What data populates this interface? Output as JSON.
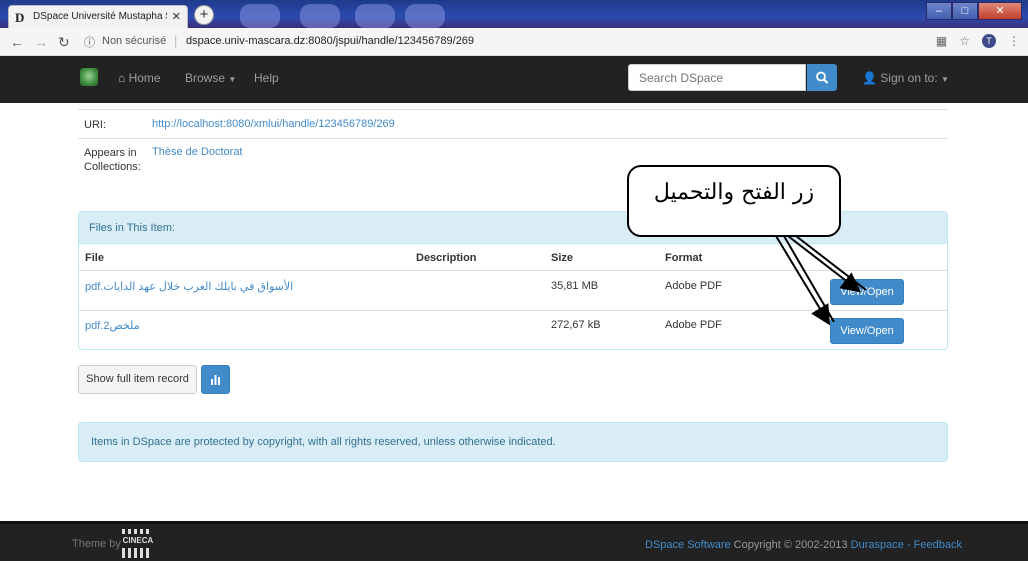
{
  "browser": {
    "tab_title": "DSpace Université Mustapha Sta",
    "tab_favicon": "D",
    "security_label": "Non sécurisé",
    "url": "dspace.univ-mascara.dz:8080/jspui/handle/123456789/269",
    "profile_initial": "T"
  },
  "navbar": {
    "home": "Home",
    "browse": "Browse",
    "help": "Help",
    "search_placeholder": "Search DSpace",
    "sign_on": "Sign on to:"
  },
  "metadata": {
    "uri_label": "URI:",
    "uri_value": "http://localhost:8080/xmlui/handle/123456789/269",
    "collections_label_1": "Appears in",
    "collections_label_2": "Collections:",
    "collections_value": "Thèse de Doctorat"
  },
  "files": {
    "panel_title": "Files in This Item:",
    "headers": {
      "file": "File",
      "description": "Description",
      "size": "Size",
      "format": "Format"
    },
    "rows": [
      {
        "file": "الأسواق في بايلك الغرب خلال عهد الدايات.pdf",
        "description": "",
        "size": "35,81 MB",
        "format": "Adobe PDF",
        "action": "View/Open"
      },
      {
        "file": "ملخص2.pdf",
        "description": "",
        "size": "272,67 kB",
        "format": "Adobe PDF",
        "action": "View/Open"
      }
    ]
  },
  "actions": {
    "full_record": "Show full item record"
  },
  "notice": "Items in DSpace are protected by copyright, with all rights reserved, unless otherwise indicated.",
  "callout": {
    "text": "زر الفتح والتحميل"
  },
  "footer": {
    "theme_by": "Theme by",
    "cineca": "CINECA",
    "dspace_software": "DSpace Software",
    "copyright": "Copyright © 2002-2013",
    "duraspace": "Duraspace",
    "separator": "-",
    "feedback": "Feedback"
  },
  "colors": {
    "navbar_bg": "#222222",
    "link": "#428bca",
    "primary": "#428bca",
    "info_bg": "#d9edf7",
    "info_text": "#31708f"
  }
}
